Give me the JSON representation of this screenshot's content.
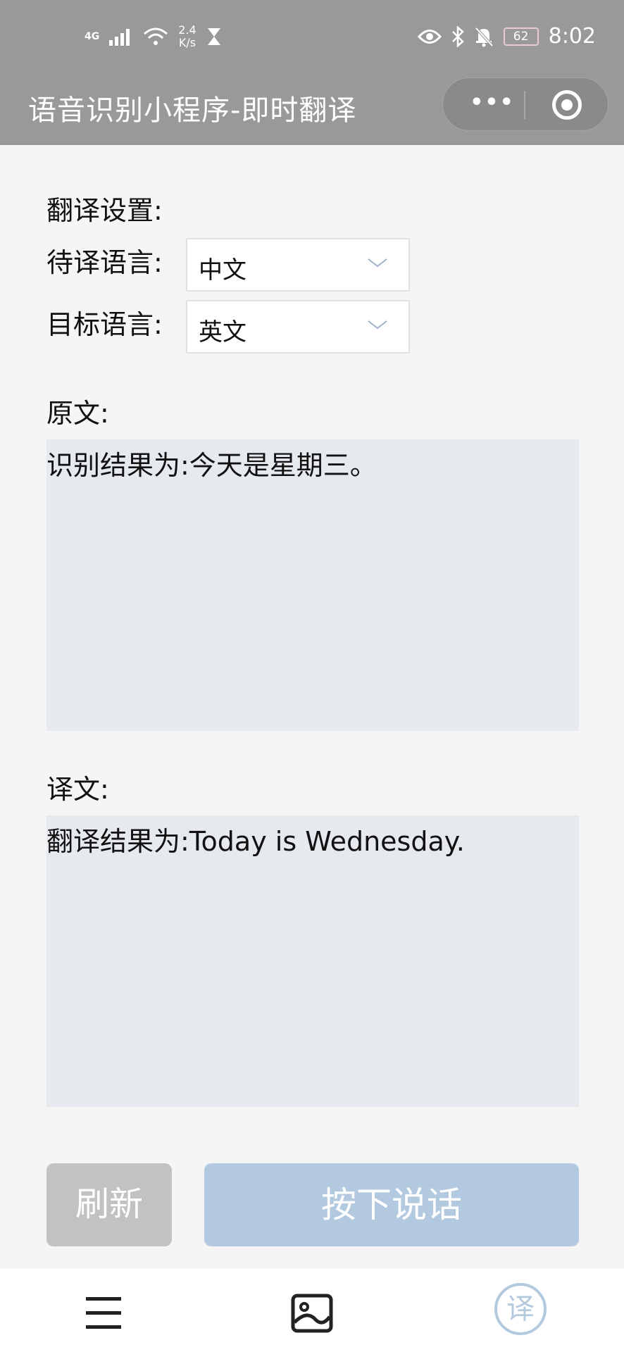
{
  "status_bar": {
    "signal": "4G",
    "net_speed_value": "2.4",
    "net_speed_unit": "K/s",
    "battery": "62",
    "time": "8:02"
  },
  "header": {
    "title": "语音识别小程序-即时翻译",
    "more_icon": "more-dots-icon",
    "close_icon": "target-circle-icon"
  },
  "settings": {
    "section_label": "翻译设置:",
    "source_label": "待译语言:",
    "source_value": "中文",
    "target_label": "目标语言:",
    "target_value": "英文"
  },
  "original": {
    "label": "原文:",
    "text": "识别结果为:今天是星期三。"
  },
  "translation": {
    "label": "译文:",
    "text": "翻译结果为:Today is Wednesday."
  },
  "buttons": {
    "refresh": "刷新",
    "talk": "按下说话"
  },
  "tabbar": {
    "translate_glyph": "译"
  },
  "colors": {
    "header_bg": "#999999",
    "text_area_bg": "#e6eaee",
    "talk_button": "#b3c9df",
    "refresh_button": "#c2c2c2"
  }
}
